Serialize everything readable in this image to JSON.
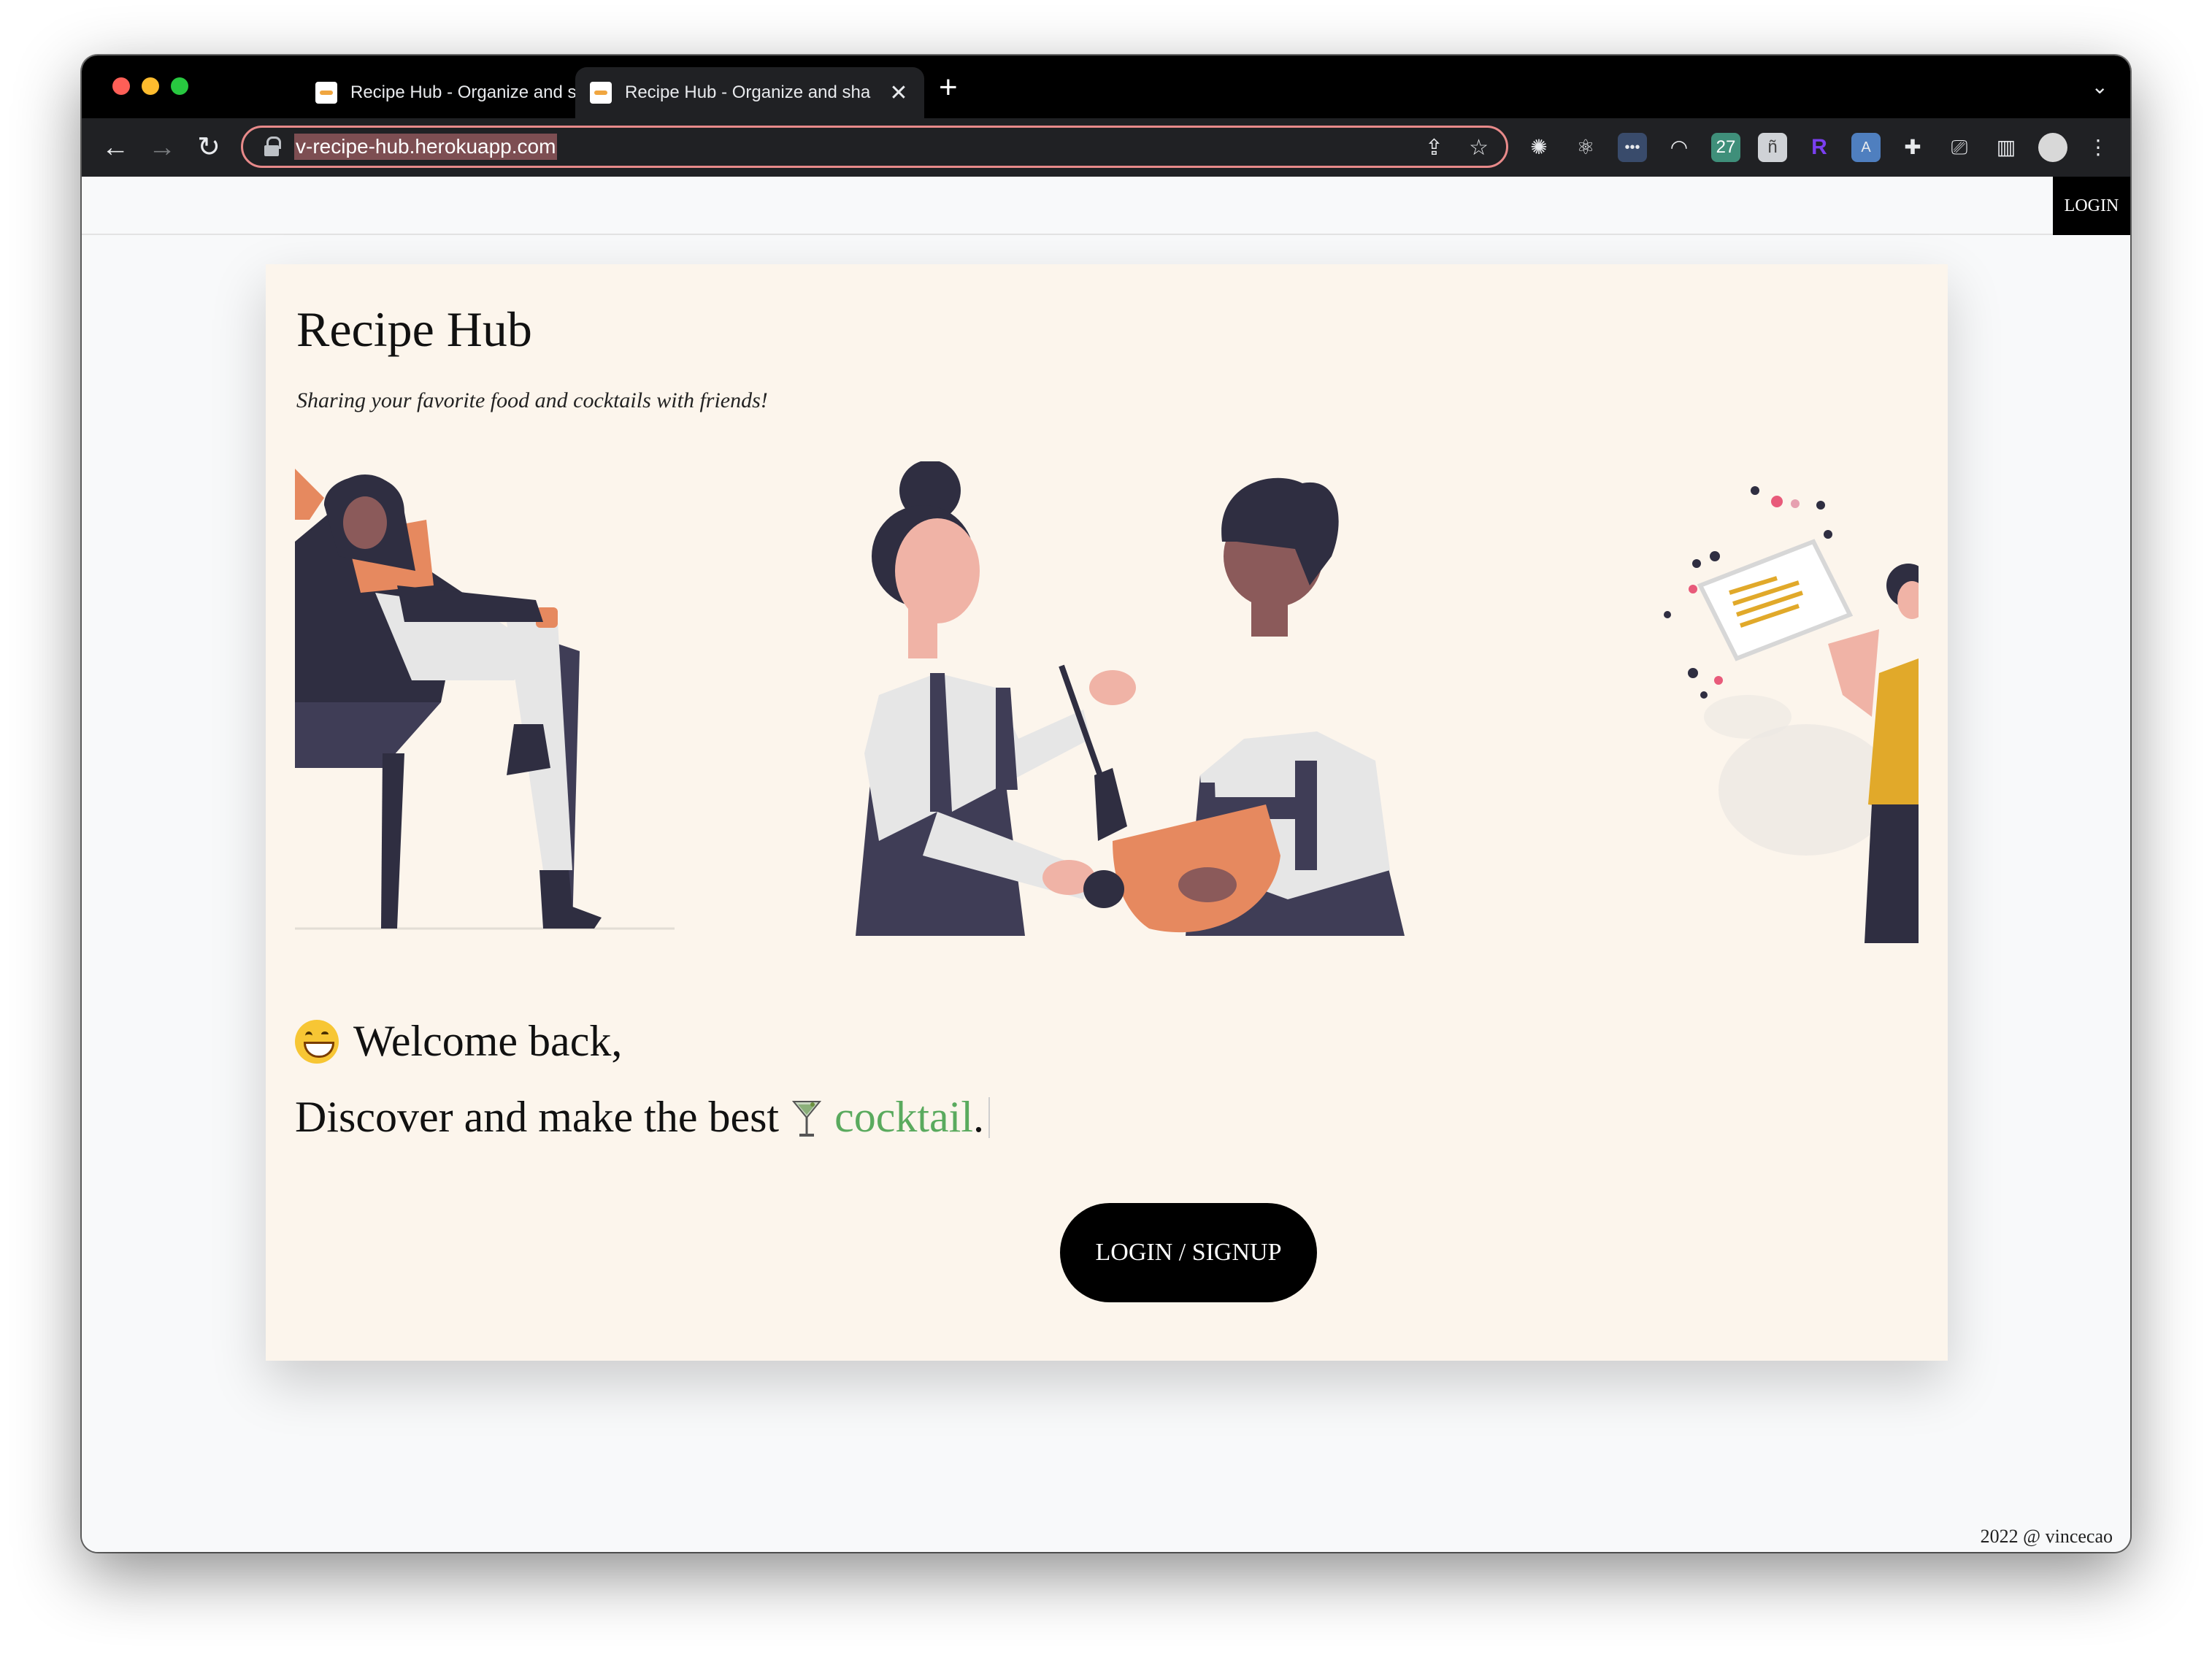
{
  "browser": {
    "tabs": [
      {
        "title": "Recipe Hub - Organize and sha",
        "close": "✕"
      },
      {
        "title": "Recipe Hub - Organize and sha",
        "close": "✕"
      }
    ],
    "new_tab": "+",
    "url": "v-recipe-hub.herokuapp.com"
  },
  "header": {
    "login_label": "LOGIN"
  },
  "hero": {
    "title": "Recipe Hub",
    "subtitle": "Sharing your favorite food and cocktails with friends!",
    "welcome": "Welcome back,",
    "discover_prefix": "Discover and make the best",
    "highlight_word": "cocktail",
    "suffix": ".",
    "cta_label": "LOGIN / SIGNUP"
  },
  "footer": {
    "text": "2022 @ vincecao"
  },
  "colors": {
    "card_bg": "#fcf5ec",
    "accent_green": "#5aaa5e",
    "dark_navy": "#3f3d56",
    "orange": "#e6895f",
    "yellow": "#e1a92a"
  }
}
